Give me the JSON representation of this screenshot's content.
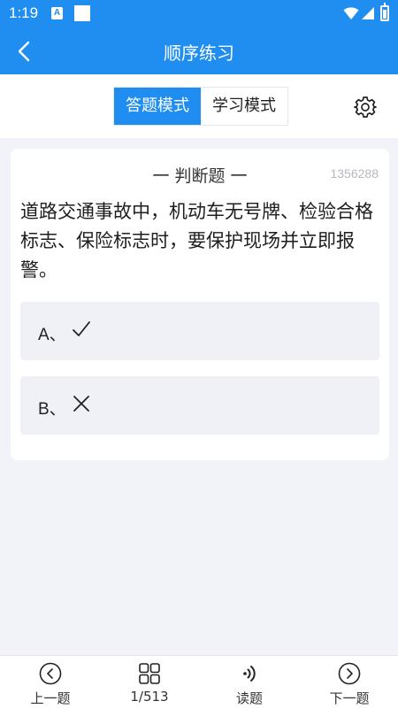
{
  "status_bar": {
    "time": "1:19",
    "notification_icon_letter": "A",
    "icons": [
      "a-notification-icon",
      "square-notification-icon",
      "wifi-icon",
      "signal-icon",
      "battery-icon"
    ]
  },
  "app_bar": {
    "title": "顺序练习",
    "back_icon": "chevron-left-icon",
    "background": "#1f8ef0"
  },
  "mode_switch": {
    "modes": [
      {
        "label": "答题模式",
        "active": true
      },
      {
        "label": "学习模式",
        "active": false
      }
    ],
    "settings_icon": "gear-icon",
    "accent": "#1f8ef0"
  },
  "question": {
    "type_label": "一 判断题 一",
    "id": "1356288",
    "text": "道路交通事故中，机动车无号牌、检验合格标志、保险标志时，要保护现场并立即报警。",
    "options": [
      {
        "label": "A、",
        "mark": "check-icon"
      },
      {
        "label": "B、",
        "mark": "cross-icon"
      }
    ]
  },
  "bottom_nav": {
    "items": [
      {
        "label": "上一题",
        "icon": "circle-chevron-left-icon"
      },
      {
        "label": "1/513",
        "icon": "grid-icon"
      },
      {
        "label": "读题",
        "icon": "audio-wave-icon"
      },
      {
        "label": "下一题",
        "icon": "circle-chevron-right-icon"
      }
    ]
  }
}
